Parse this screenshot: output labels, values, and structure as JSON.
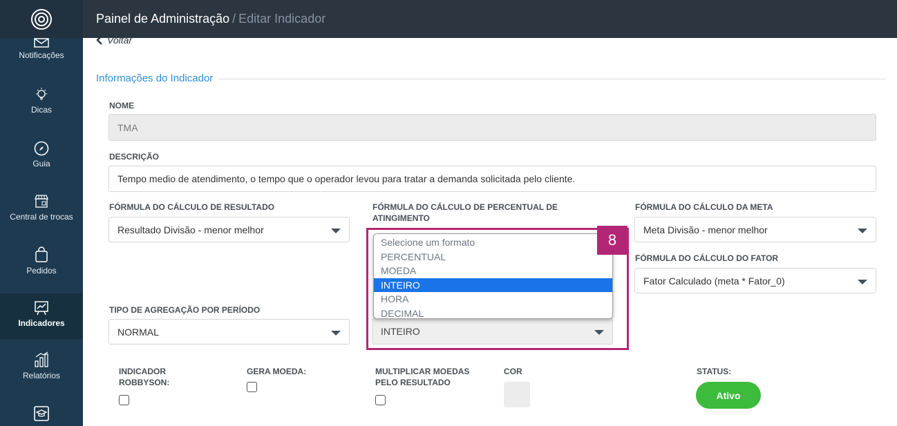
{
  "header": {
    "title": "Painel de Administração",
    "separator": "/",
    "subtitle": "Editar Indicador"
  },
  "back_label": "Voltar",
  "sidebar": {
    "items": [
      {
        "label": "Notificações",
        "icon": "mail-icon"
      },
      {
        "label": "Dicas",
        "icon": "lightbulb-icon"
      },
      {
        "label": "Guia",
        "icon": "compass-icon"
      },
      {
        "label": "Central de trocas",
        "icon": "store-icon"
      },
      {
        "label": "Pedidos",
        "icon": "shopping-bag-icon"
      },
      {
        "label": "Indicadores",
        "icon": "chart-board-icon",
        "active": true
      },
      {
        "label": "Relatórios",
        "icon": "bar-chart-icon"
      }
    ]
  },
  "section": {
    "title": "Informações do Indicador"
  },
  "form": {
    "nome": {
      "label": "NOME",
      "value": "TMA"
    },
    "descricao": {
      "label": "DESCRIÇÃO",
      "value": "Tempo medio de atendimento, o tempo que o operador levou para tratar a demanda solicitada pelo cliente."
    },
    "formula_resultado": {
      "label": "FÓRMULA DO CÁLCULO DE RESULTADO",
      "value": "Resultado Divisão - menor melhor"
    },
    "formula_percentual": {
      "label": "FÓRMULA DO CÁLCULO DE PERCENTUAL DE ATINGIMENTO"
    },
    "formula_meta": {
      "label": "FÓRMULA DO CÁLCULO DA META",
      "value": "Meta Divisão - menor melhor"
    },
    "formula_fator": {
      "label": "FÓRMULA DO CÁLCULO DO FATOR",
      "value": "Fator Calculado (meta * Fator_0)"
    },
    "agregacao": {
      "label": "TIPO DE AGREGAÇÃO POR PERÍODO",
      "value": "NORMAL"
    },
    "formato": {
      "value": "INTEIRO"
    },
    "indicador_robbyson": {
      "label": "INDICADOR ROBBYSON:"
    },
    "gera_moeda": {
      "label": "GERA MOEDA:"
    },
    "multiplicar": {
      "label": "MULTIPLICAR MOEDAS PELO RESULTADO"
    },
    "cor": {
      "label": "COR"
    },
    "status": {
      "label": "STATUS:",
      "button": "Ativo"
    }
  },
  "dropdown": {
    "options": [
      "Selecione um formato",
      "PERCENTUAL",
      "MOEDA",
      "INTEIRO",
      "HORA",
      "DECIMAL"
    ],
    "selected_index": 3
  },
  "annotation": {
    "badge": "8"
  },
  "colors": {
    "sidebar": "#1d3a50",
    "topbar": "#2b3640",
    "accent": "#2d8fd6",
    "highlight": "#b32675",
    "selected": "#1a73e8",
    "status_green": "#3dbb3d"
  }
}
